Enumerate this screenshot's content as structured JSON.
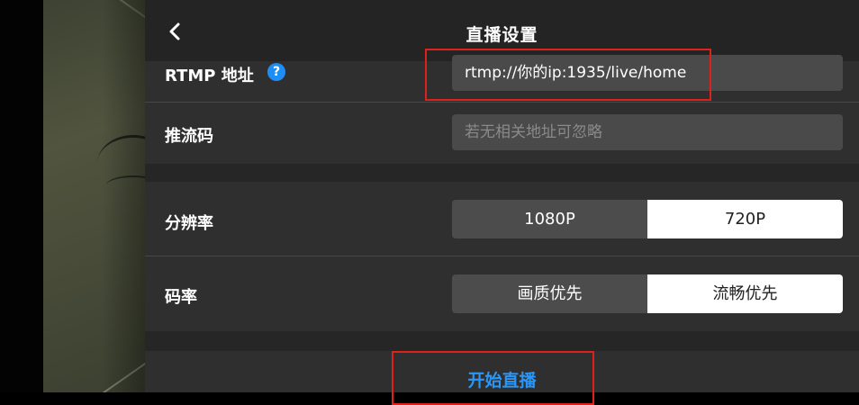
{
  "header": {
    "title": "直播设置"
  },
  "form": {
    "rtmp": {
      "label": "RTMP 地址",
      "value": "rtmp://你的ip:1935/live/home"
    },
    "stream_key": {
      "label": "推流码",
      "placeholder": "若无相关地址可忽略"
    },
    "resolution": {
      "label": "分辨率",
      "options": [
        "1080P",
        "720P"
      ],
      "selected": "720P"
    },
    "bitrate": {
      "label": "码率",
      "options": [
        "画质优先",
        "流畅优先"
      ],
      "selected": "流畅优先"
    }
  },
  "actions": {
    "start_label": "开始直播"
  },
  "colors": {
    "accent": "#2a97f8",
    "help_icon": "#1e8ef5",
    "highlight_box": "#e0201b"
  }
}
